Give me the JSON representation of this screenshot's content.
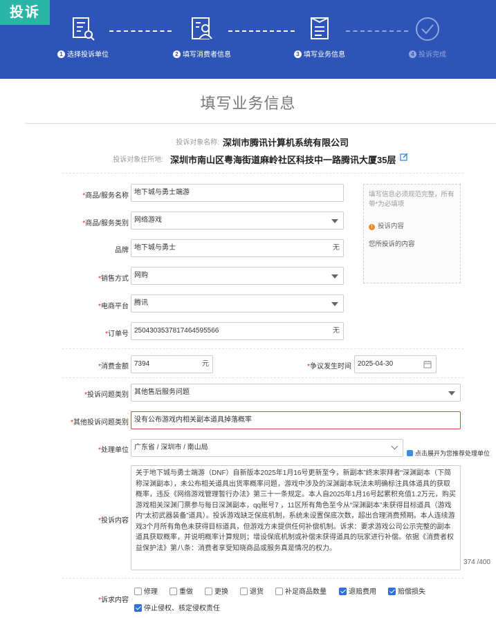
{
  "brand": {
    "tag": "投诉"
  },
  "steps": [
    {
      "num": "1",
      "label": "选择投诉单位",
      "icon": "document-search-icon",
      "state": "done"
    },
    {
      "num": "2",
      "label": "填写消费者信息",
      "icon": "person-form-icon",
      "state": "done"
    },
    {
      "num": "3",
      "label": "填写业务信息",
      "icon": "clipboard-icon",
      "state": "current"
    },
    {
      "num": "4",
      "label": "投诉完成",
      "icon": "check-circle-icon",
      "state": "pending"
    }
  ],
  "page": {
    "title": "填写业务信息"
  },
  "target": {
    "name_key": "投诉对象名称:",
    "name_value": "深圳市腾讯计算机系统有限公司",
    "addr_key": "投诉对象住所地:",
    "addr_value": "深圳市南山区粤海街道麻岭社区科技中一路腾讯大厦35层"
  },
  "form": {
    "product_name": {
      "label": "商品/服务名称",
      "value": "地下城与勇士端游"
    },
    "product_type": {
      "label": "商品/服务类别",
      "value": "网络游戏"
    },
    "brand": {
      "label": "品牌",
      "value": "地下城与勇士",
      "suffix": "无"
    },
    "sales_method": {
      "label": "销售方式",
      "value": "网购"
    },
    "platform": {
      "label": "电商平台",
      "value": "腾讯"
    },
    "order_no": {
      "label": "订单号",
      "value": "2504303537817464595566",
      "suffix": "无"
    },
    "amount": {
      "label": "消费金额",
      "value": "7394",
      "suffix": "元"
    },
    "dispute_time": {
      "label": "争议发生时间",
      "value": "2025-04-30"
    },
    "issue_type": {
      "label": "投诉问题类别",
      "value": "其他售后服务问题"
    },
    "other_issue": {
      "label": "其他投诉问题类别",
      "value": "没有公布游戏内相关副本道具掉落概率"
    },
    "handler": {
      "label": "处理单位",
      "value": "广东省 / 深圳市 / 南山局"
    },
    "handler_hint": "点击展开为您推荐处理单位",
    "content": {
      "label": "投诉内容",
      "value": "关于地下城与勇士端游（DNF）自新版本2025年1月16号更新至今，新副本”终末崇拜者“深渊副本（下简称深渊副本），未公布相关道具出货率概率问题，游戏中涉及的深渊副本玩法未明确标注具体道具的获取概率，违反《网络游戏管理暂行办法》第三十一条规定。本人自2025年1月16号起累积充值1.2万元，购买游戏相关深渊门票参与每日深渊副本，qq账号7             ，11区所有角色至今从“深渊副本”未获得目标道具（游戏内“太初武器装备”道具）。投诉游戏缺乏保底机制，系统未设置保底次数，超出合理消费预期。本人连续游戏3个月所有角色未获得目标道具，但游戏方未提供任何补偿机制。诉求：要求游戏公司公示完整的副本道具获取概率，并说明概率计算规则；增设保底机制或补偿未获得道具的玩家进行补偿。依据《消费者权益保护法》第八条：消费者享受知晓商品或服务真是情况的权力。",
      "counter": "374  /400"
    },
    "demands": {
      "label": "诉求内容",
      "options": [
        {
          "label": "修理",
          "checked": false
        },
        {
          "label": "重做",
          "checked": false
        },
        {
          "label": "更换",
          "checked": false
        },
        {
          "label": "退货",
          "checked": false
        },
        {
          "label": "补足商品数量",
          "checked": false
        },
        {
          "label": "退赔费用",
          "checked": true
        },
        {
          "label": "赔偿损失",
          "checked": true
        },
        {
          "label": "停止侵权、核定侵权责任",
          "checked": true
        }
      ]
    }
  },
  "tip": {
    "line1": "填写信息必须规范完整，所有带*为必填项",
    "line2": "投诉内容",
    "line3": "您所投诉的内容"
  },
  "colors": {
    "header": "#2f54b8",
    "brand_tag": "#2ab5a6",
    "required": "#e02020",
    "checkbox": "#2f6fd6"
  }
}
